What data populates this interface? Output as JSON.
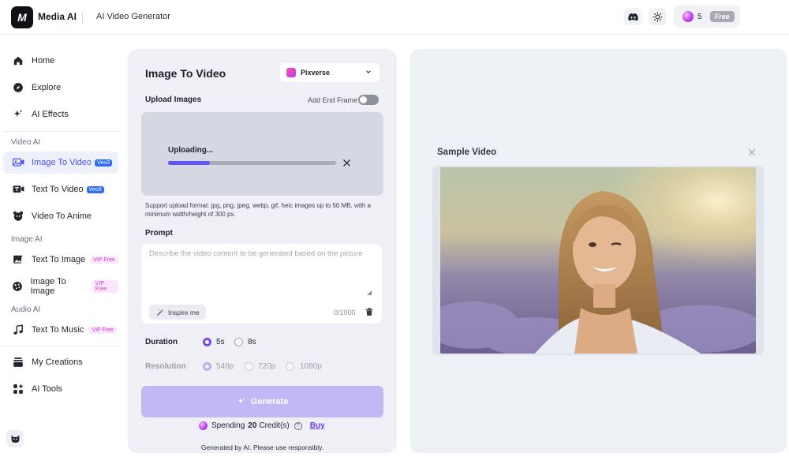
{
  "header": {
    "brand": "Media AI",
    "logo_text": "M",
    "page_label": "AI Video Generator",
    "credits_count": "5",
    "plan_badge": "Free"
  },
  "sidebar": {
    "items": [
      {
        "label": "Home",
        "icon": "home-icon"
      },
      {
        "label": "Explore",
        "icon": "compass-icon"
      },
      {
        "label": "AI Effects",
        "icon": "sparkle-icon"
      }
    ],
    "sections": [
      {
        "title": "Video AI",
        "items": [
          {
            "label": "Image To Video",
            "tag": "Veo3",
            "active": true,
            "icon": "image-video-icon"
          },
          {
            "label": "Text To Video",
            "tag": "Veo3",
            "icon": "text-video-icon"
          },
          {
            "label": "Video To Anime",
            "icon": "anime-icon"
          }
        ]
      },
      {
        "title": "Image AI",
        "items": [
          {
            "label": "Text To Image",
            "tag": "VIP Free",
            "icon": "text-image-icon"
          },
          {
            "label": "Image To Image",
            "tag": "VIP Free",
            "icon": "image-image-icon"
          }
        ]
      },
      {
        "title": "Audio AI",
        "items": [
          {
            "label": "Text To Music",
            "tag": "VIP Free",
            "icon": "music-icon"
          }
        ]
      }
    ],
    "bottom_items": [
      {
        "label": "My Creations",
        "icon": "stack-icon"
      },
      {
        "label": "AI Tools",
        "icon": "grid-plus-icon"
      }
    ]
  },
  "form": {
    "title": "Image To Video",
    "model": "Pixverse",
    "upload_label": "Upload Images",
    "end_frame_label": "Add End Frame",
    "end_frame_enabled": false,
    "uploading_text": "Uploading...",
    "upload_progress": 0.25,
    "upload_hint": "Support upload format: jpg, png, jpeg, webp, gif, heic images up to 50 MB, with a minimum width/height of 300 px.",
    "prompt_label": "Prompt",
    "prompt_value": "",
    "prompt_placeholder": "Describe the video content to be generated based on the picture",
    "inspire_label": "Inspire me",
    "char_count": "0/1000",
    "duration_label": "Duration",
    "duration_options": [
      "5s",
      "8s"
    ],
    "duration_selected": "5s",
    "resolution_label": "Resolution",
    "resolution_options": [
      "540p",
      "720p",
      "1080p"
    ],
    "resolution_selected": "540p",
    "generate_label": "Generate",
    "spending_prefix": "Spending",
    "spending_amount": "20",
    "spending_suffix": "Credit(s)",
    "buy_label": "Buy",
    "disclaimer": "Generated by AI. Please use responsibly."
  },
  "preview": {
    "title": "Sample Video"
  },
  "colors": {
    "accent": "#5c5af2",
    "generate_disabled": "#c1b8f6",
    "active_nav": "#4a4ff0",
    "veo_tag": "#2f6df6",
    "vip_tag": "#d337d8"
  }
}
